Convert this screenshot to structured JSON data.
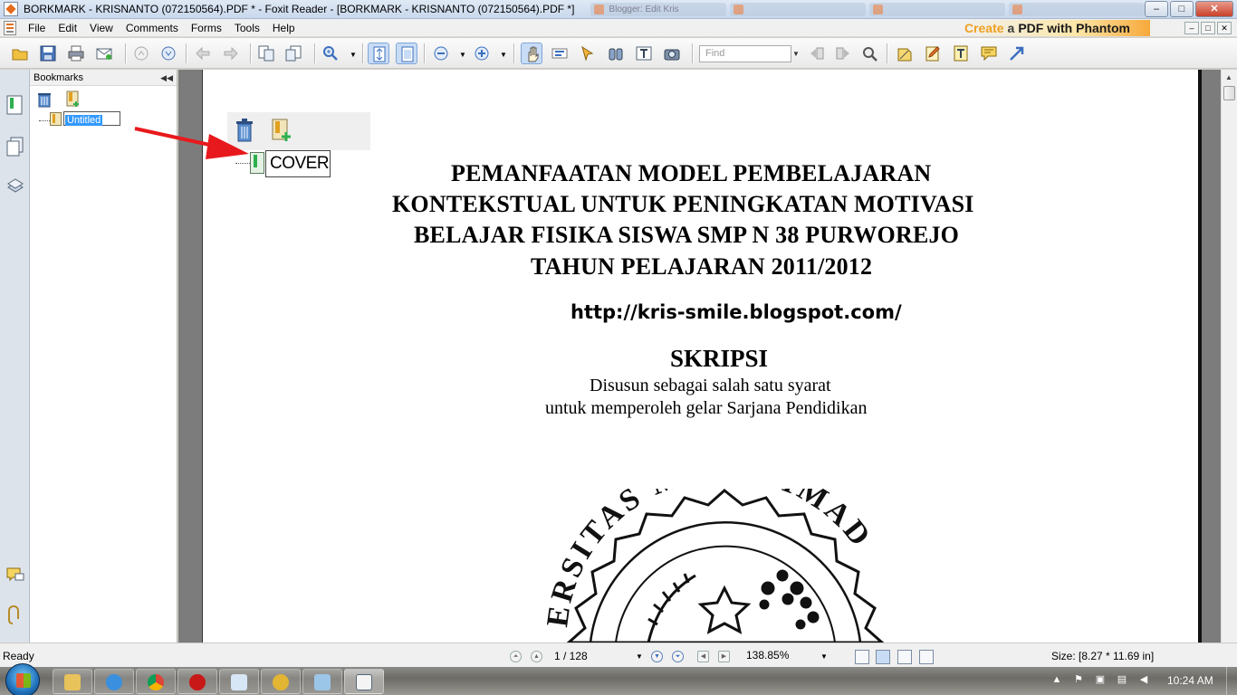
{
  "window": {
    "title": "BORKMARK - KRISNANTO (072150564).PDF * - Foxit Reader - [BORKMARK - KRISNANTO (072150564).PDF *]",
    "ghost_tabs": [
      "Blogger: Edit Kris",
      "",
      "",
      ""
    ],
    "buttons": {
      "minimize": "–",
      "maximize": "□",
      "close": "✕"
    }
  },
  "menu": {
    "items": [
      "File",
      "Edit",
      "View",
      "Comments",
      "Forms",
      "Tools",
      "Help"
    ],
    "promo": {
      "p1": "Create",
      "p2": "a",
      "p3": "PDF with Phantom"
    },
    "mdi": [
      "–",
      "□",
      "✕"
    ]
  },
  "toolbar": {
    "find_placeholder": "Find",
    "icons": [
      "open-icon",
      "save-icon",
      "print-icon",
      "email-icon",
      "nav-up-icon",
      "nav-down-icon",
      "back-icon",
      "forward-icon",
      "extract-icon",
      "insert-icon",
      "zoom-in-icon",
      "fit-page-icon",
      "fit-width-icon",
      "zoom-out-icon",
      "zoom-plus-icon",
      "hand-icon",
      "select-text-icon",
      "select-icon",
      "find-icon",
      "typewriter-icon",
      "snapshot-icon",
      "search-prev-icon",
      "search-next-icon",
      "search-icon",
      "note-icon",
      "pen-icon",
      "textbox-icon",
      "comment-icon",
      "arrow-tool-icon"
    ],
    "accent": "#3b6fbf"
  },
  "bookmarks": {
    "panel_title": "Bookmarks",
    "collapse": "◀◀",
    "selected_edit_text": "Untitled"
  },
  "callout": {
    "edit_text": "COVER"
  },
  "document": {
    "title_lines": [
      "PEMANFAATAN MODEL PEMBELAJARAN",
      "KONTEKSTUAL UNTUK PENINGKATAN MOTIVASI",
      "BELAJAR FISIKA SISWA SMP N 38 PURWOREJO",
      "TAHUN PELAJARAN 2011/2012"
    ],
    "url": "http://kris-smile.blogspot.com/",
    "heading": "SKRIPSI",
    "sub_lines": [
      "Disusun sebagai salah satu syarat",
      "untuk memperoleh gelar Sarjana Pendidikan"
    ],
    "seal_text": "ERSITAS MUHAMMAD"
  },
  "status": {
    "ready": "Ready",
    "page": "1 / 128",
    "zoom": "138.85%",
    "size": "Size: [8.27 * 11.69 in]"
  },
  "taskbar": {
    "clock": "10:24 AM",
    "apps": [
      "explorer-icon",
      "ie-icon",
      "chrome-icon",
      "media-icon",
      "notepad-icon",
      "app-icon",
      "paint-icon",
      "foxit-icon"
    ]
  },
  "colors": {
    "annotation_arrow": "#e8191c",
    "selection": "#3399ff",
    "bookmark_green": "#2db04d"
  }
}
